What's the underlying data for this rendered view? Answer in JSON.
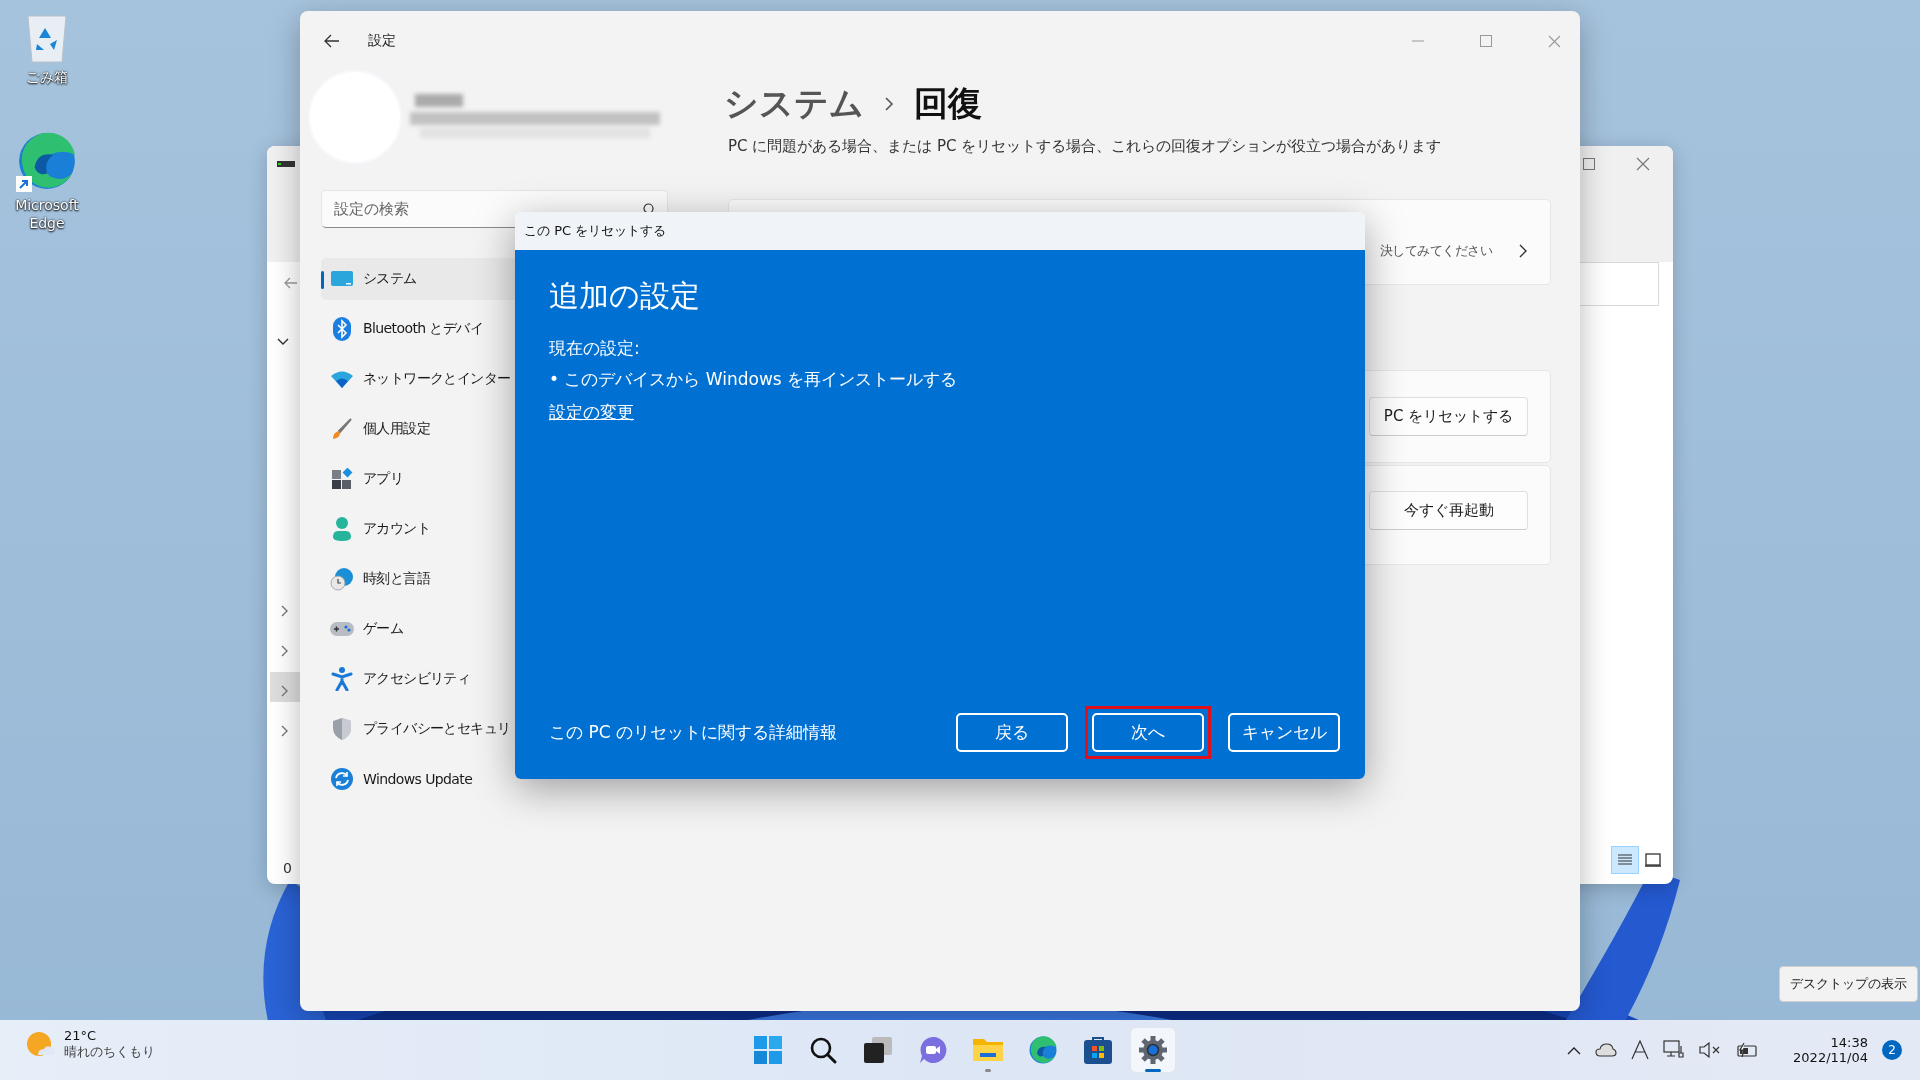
{
  "desktop_icons": [
    {
      "kind": "recycle-bin",
      "label": "ごみ箱"
    },
    {
      "kind": "edge",
      "label": "Microsoft Edge"
    }
  ],
  "back_window": {
    "status_text": "0"
  },
  "settings_window": {
    "title": "設定",
    "search": {
      "placeholder": "設定の検索"
    },
    "sidebar": {
      "items": [
        {
          "kind": "system",
          "label": "システム",
          "selected": true
        },
        {
          "kind": "bluetooth",
          "label": "Bluetooth とデバイ",
          "selected": false
        },
        {
          "kind": "network",
          "label": "ネットワークとインター",
          "selected": false
        },
        {
          "kind": "personalize",
          "label": "個人用設定",
          "selected": false
        },
        {
          "kind": "apps",
          "label": "アプリ",
          "selected": false
        },
        {
          "kind": "account",
          "label": "アカウント",
          "selected": false
        },
        {
          "kind": "time",
          "label": "時刻と言語",
          "selected": false
        },
        {
          "kind": "game",
          "label": "ゲーム",
          "selected": false
        },
        {
          "kind": "accessibility",
          "label": "アクセシビリティ",
          "selected": false
        },
        {
          "kind": "privacy",
          "label": "プライバシーとセキュリ",
          "selected": false
        },
        {
          "kind": "update",
          "label": "Windows Update",
          "selected": false
        }
      ]
    },
    "breadcrumb": [
      "システム",
      "回復"
    ],
    "description": "PC に問題がある場合、または PC をリセットする場合、これらの回復オプションが役立つ場合があります",
    "cards": [
      {
        "kind": "link",
        "text": "決してみてください"
      },
      {
        "kind": "button",
        "text": "PC をリセットする"
      },
      {
        "kind": "button",
        "text": "今すぐ再起動"
      }
    ]
  },
  "dialog": {
    "title": "この PC をリセットする",
    "heading": "追加の設定",
    "current_label": "現在の設定:",
    "bullets": [
      "• このデバイスから Windows を再インストールする"
    ],
    "change_link": "設定の変更",
    "info_link": "この PC のリセットに関する詳細情報",
    "buttons": [
      {
        "label": "戻る",
        "highlighted": false
      },
      {
        "label": "次へ",
        "highlighted": true
      },
      {
        "label": "キャンセル",
        "highlighted": false
      }
    ]
  },
  "desktop_tooltip": "デスクトップの表示",
  "taskbar": {
    "weather": {
      "temperature": "21°C",
      "condition": "晴れのちくもり"
    },
    "apps": [
      {
        "kind": "start",
        "active": false,
        "running": false
      },
      {
        "kind": "search",
        "active": false,
        "running": false
      },
      {
        "kind": "taskview",
        "active": false,
        "running": false
      },
      {
        "kind": "chat",
        "active": false,
        "running": false
      },
      {
        "kind": "explorer",
        "active": false,
        "running": true
      },
      {
        "kind": "edge",
        "active": false,
        "running": false
      },
      {
        "kind": "store",
        "active": false,
        "running": false
      },
      {
        "kind": "settings",
        "active": true,
        "running": true
      }
    ],
    "tray": {
      "time": "14:38",
      "date": "2022/11/04",
      "notification_count": "2"
    }
  }
}
